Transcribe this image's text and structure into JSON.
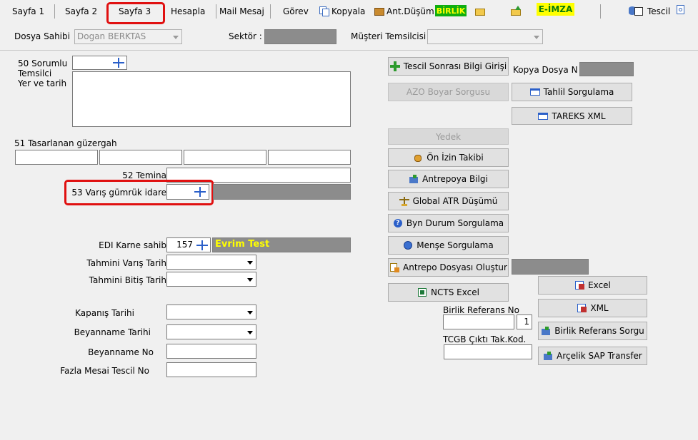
{
  "menu": {
    "sayfa1": "Sayfa 1",
    "sayfa2": "Sayfa 2",
    "sayfa3": "Sayfa 3",
    "hesapla": "Hesapla",
    "mail": "Mail Mesaj",
    "gorev": "Görev",
    "kopyala": "Kopyala",
    "ant_dusum": "Ant.Düşüm",
    "birlik": "BİRLİK",
    "eimza": "E-İMZA",
    "tescil": "Tescil"
  },
  "header": {
    "dosya_sahibi_label": "Dosya Sahibi",
    "dosya_sahibi_value": "Dogan BERKTAS",
    "sektor_label": "Sektör :",
    "musteri_label": "Müşteri Temsilcisi"
  },
  "form": {
    "f50_label_1": "50 Sorumlu",
    "f50_label_2": "Temsilci",
    "f50_label_3": "Yer ve tarih",
    "f51_label": "51 Tasarlanan güzergah",
    "f52_label": "52 Temina",
    "f53_label": "53 Varış gümrük idare",
    "edi_label": "EDI Karne sahib",
    "edi_value": "157",
    "edi_name": "Evrim Test",
    "tahmini_varis": "Tahmini Varış Tarih",
    "tahmini_bitis": "Tahmini Bitiş Tarih",
    "kapanis": "Kapanış Tarihi",
    "beyanname_tarihi": "Beyanname Tarihi",
    "beyanname_no": "Beyanname No",
    "fazla_mesai": "Fazla Mesai Tescil No"
  },
  "buttons": {
    "tescil_sonrasi": "Tescil Sonrası Bilgi Girişi",
    "azo": "AZO Boyar Sorgusu",
    "yedek": "Yedek",
    "on_izin": "Ön İzin Takibi",
    "antrepoya": "Antrepoya Bilgi",
    "global_atr": "Global ATR Düşümü",
    "byn": "Byn Durum Sorgulama",
    "mense": "Menşe Sorgulama",
    "antrepo_dosyasi": "Antrepo Dosyası Oluştur",
    "ncts": "NCTS Excel",
    "tahlil": "Tahlil Sorgulama",
    "tareks": "TAREKS XML",
    "excel": "Excel",
    "xml": "XML",
    "birlik_ref_sorgu": "Birlik Referans Sorgu",
    "arcelik": "Arçelik SAP Transfer"
  },
  "right": {
    "kopya_dosya_label": "Kopya Dosya N",
    "birlik_ref_label": "Birlik Referans No",
    "birlik_ref_count": "1",
    "tcgb_label": "TCGB Çıktı Tak.Kod."
  },
  "colors": {
    "highlight": "#e01010",
    "birlik_bg": "#0fae0f",
    "eimza_bg": "#ffff00",
    "gray_field": "#8c8c8c",
    "edi_name_color": "#ffff00"
  }
}
